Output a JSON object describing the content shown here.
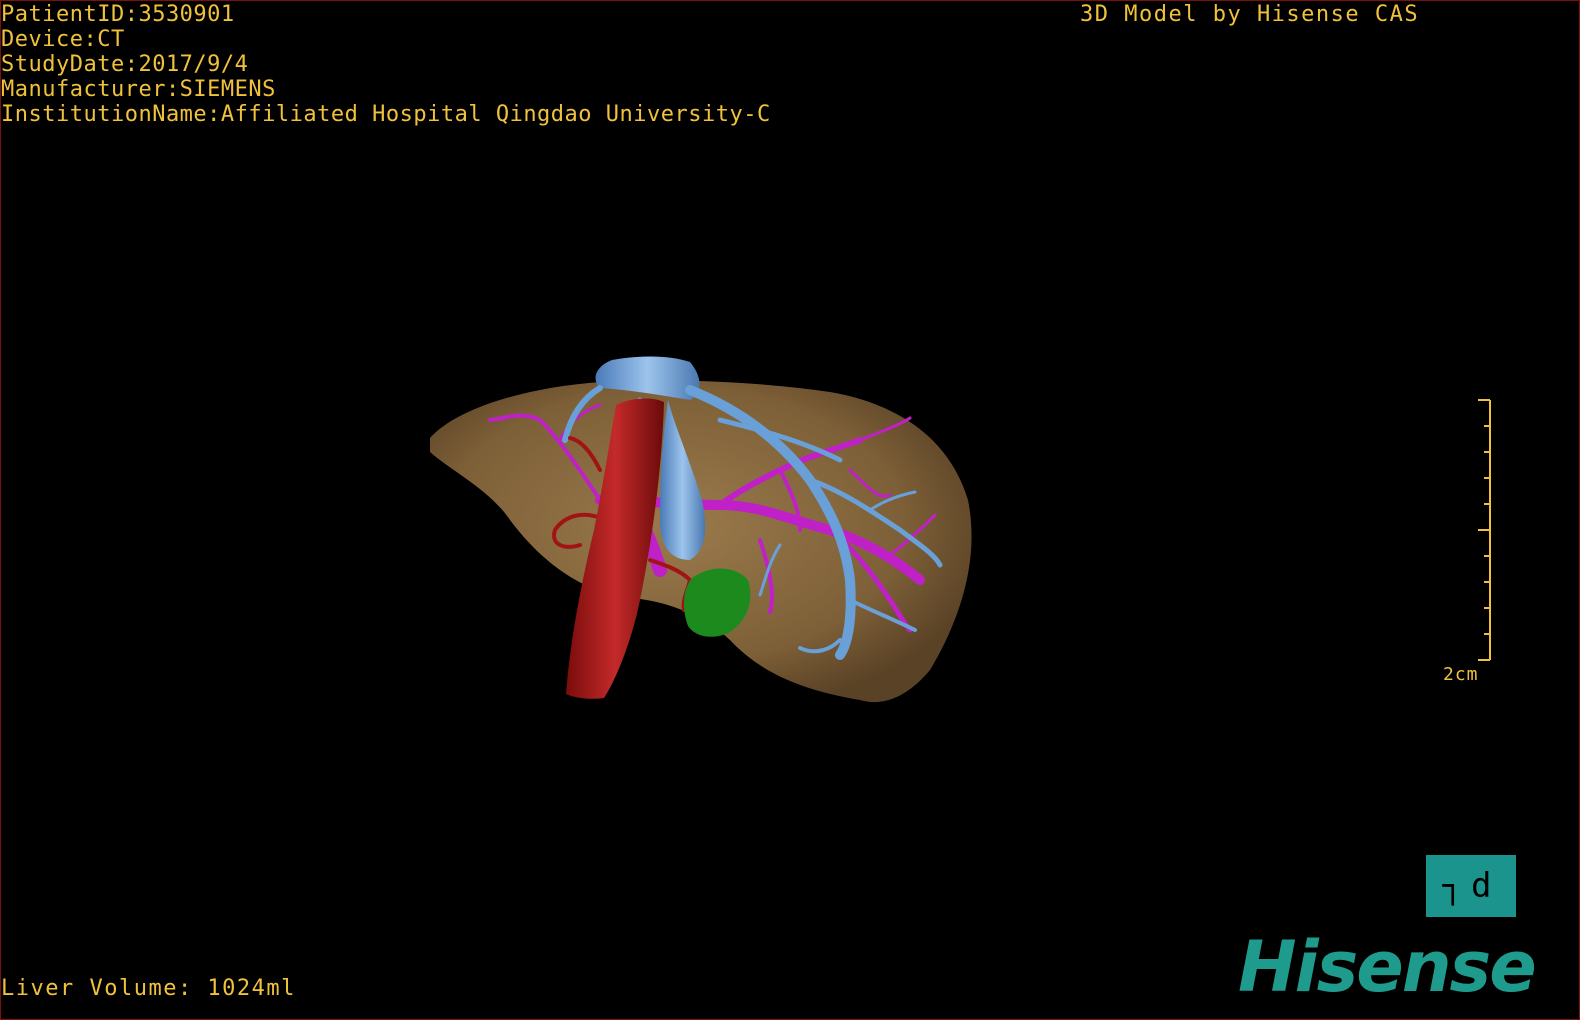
{
  "overlay_info": {
    "patient_id": "PatientID:3530901",
    "device": "Device:CT",
    "study_date": "StudyDate:2017/9/4",
    "manufacturer": "Manufacturer:SIEMENS",
    "institution": "InstitutionName:Affiliated Hospital Qingdao University-C"
  },
  "header_right": "3D Model by Hisense CAS",
  "footer": {
    "liver_volume": "Liver Volume: 1024ml"
  },
  "scale_bar": {
    "label": "2cm"
  },
  "orientation_cube": {
    "label": "┐d",
    "icon": "orientation-cube-icon"
  },
  "brand_logo": "Hisense",
  "colors": {
    "overlay_text": "#f0c23c",
    "liver": "#8a6a40",
    "hepatic_vein": "#6aa0d8",
    "portal_vein": "#c020c8",
    "artery": "#b01818",
    "lesion": "#1c8a1c",
    "brand": "#1f9b8d"
  }
}
